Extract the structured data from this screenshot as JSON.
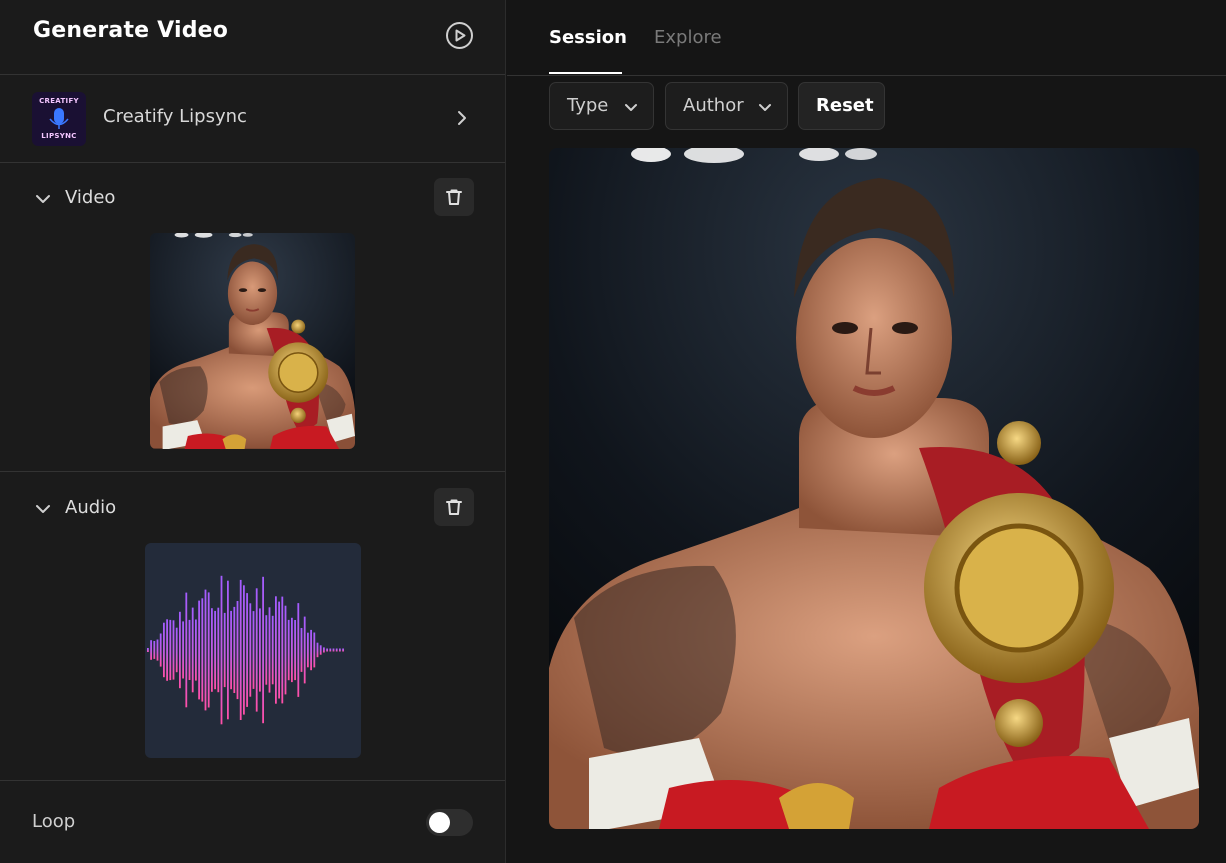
{
  "left_panel": {
    "title": "Generate Video",
    "model": {
      "name": "Creatify Lipsync",
      "thumb_line1": "CREATIFY",
      "thumb_line2": "LIPSYNC"
    },
    "sections": {
      "video": {
        "label": "Video"
      },
      "audio": {
        "label": "Audio"
      }
    },
    "loop": {
      "label": "Loop",
      "enabled": false
    }
  },
  "right_panel": {
    "tabs": [
      {
        "label": "Session",
        "active": true
      },
      {
        "label": "Explore",
        "active": false
      }
    ],
    "filters": {
      "type_label": "Type",
      "author_label": "Author",
      "reset_label": "Reset"
    }
  },
  "icons": {
    "play": "play-circle-icon",
    "model_chevron": "chevron-right-icon",
    "section_chevron": "chevron-down-icon",
    "trash": "trash-icon",
    "filter_chevron": "chevron-down-icon"
  },
  "colors": {
    "background": "#151515",
    "panel": "#1b1b1b",
    "waveform_top": "#a35cff",
    "waveform_bottom": "#ff4fa8",
    "audio_bg": "#232b3a",
    "belt_red": "#a81d24",
    "belt_gold": "#c99a2e"
  }
}
